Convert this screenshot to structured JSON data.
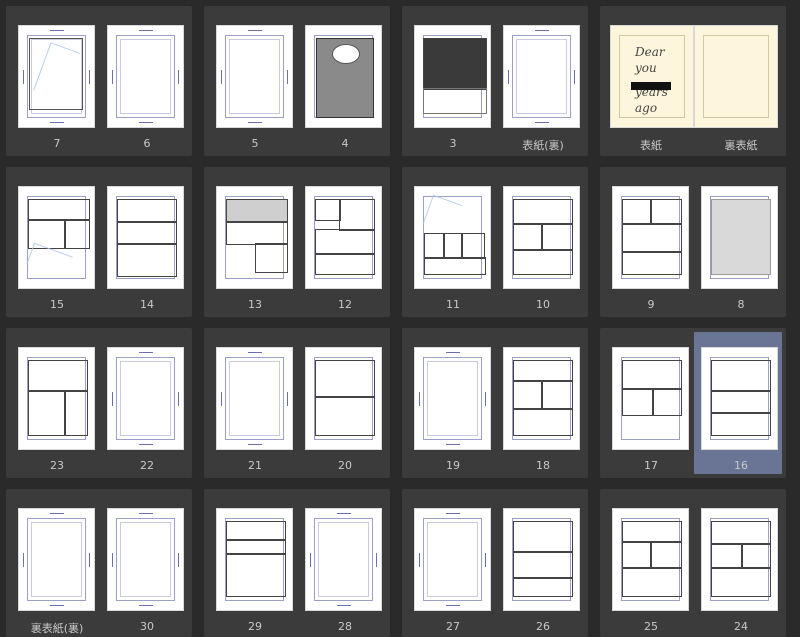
{
  "colors": {
    "background": "#2a2a2a",
    "spread_bg": "#3b3b3b",
    "selection": "#6a7595",
    "label": "#c8c8c8",
    "cover": "#fdf6dc"
  },
  "rows": [
    [
      {
        "left": "7",
        "right": "6"
      },
      {
        "left": "5",
        "right": "4"
      },
      {
        "left": "3",
        "right": "表紙(裏)"
      },
      {
        "left": "表紙",
        "right": "裏表紙"
      }
    ],
    [
      {
        "left": "15",
        "right": "14"
      },
      {
        "left": "13",
        "right": "12"
      },
      {
        "left": "11",
        "right": "10"
      },
      {
        "left": "9",
        "right": "8"
      }
    ],
    [
      {
        "left": "23",
        "right": "22"
      },
      {
        "left": "21",
        "right": "20"
      },
      {
        "left": "19",
        "right": "18"
      },
      {
        "left": "17",
        "right": "16"
      }
    ],
    [
      {
        "left": "裏表紙(裏)",
        "right": "30"
      },
      {
        "left": "29",
        "right": "28"
      },
      {
        "left": "27",
        "right": "26"
      },
      {
        "left": "25",
        "right": "24"
      }
    ]
  ],
  "cover_text": {
    "line1": "Dear",
    "line2": "you",
    "line3": "years",
    "line4": "ago"
  },
  "selected_page": "16"
}
